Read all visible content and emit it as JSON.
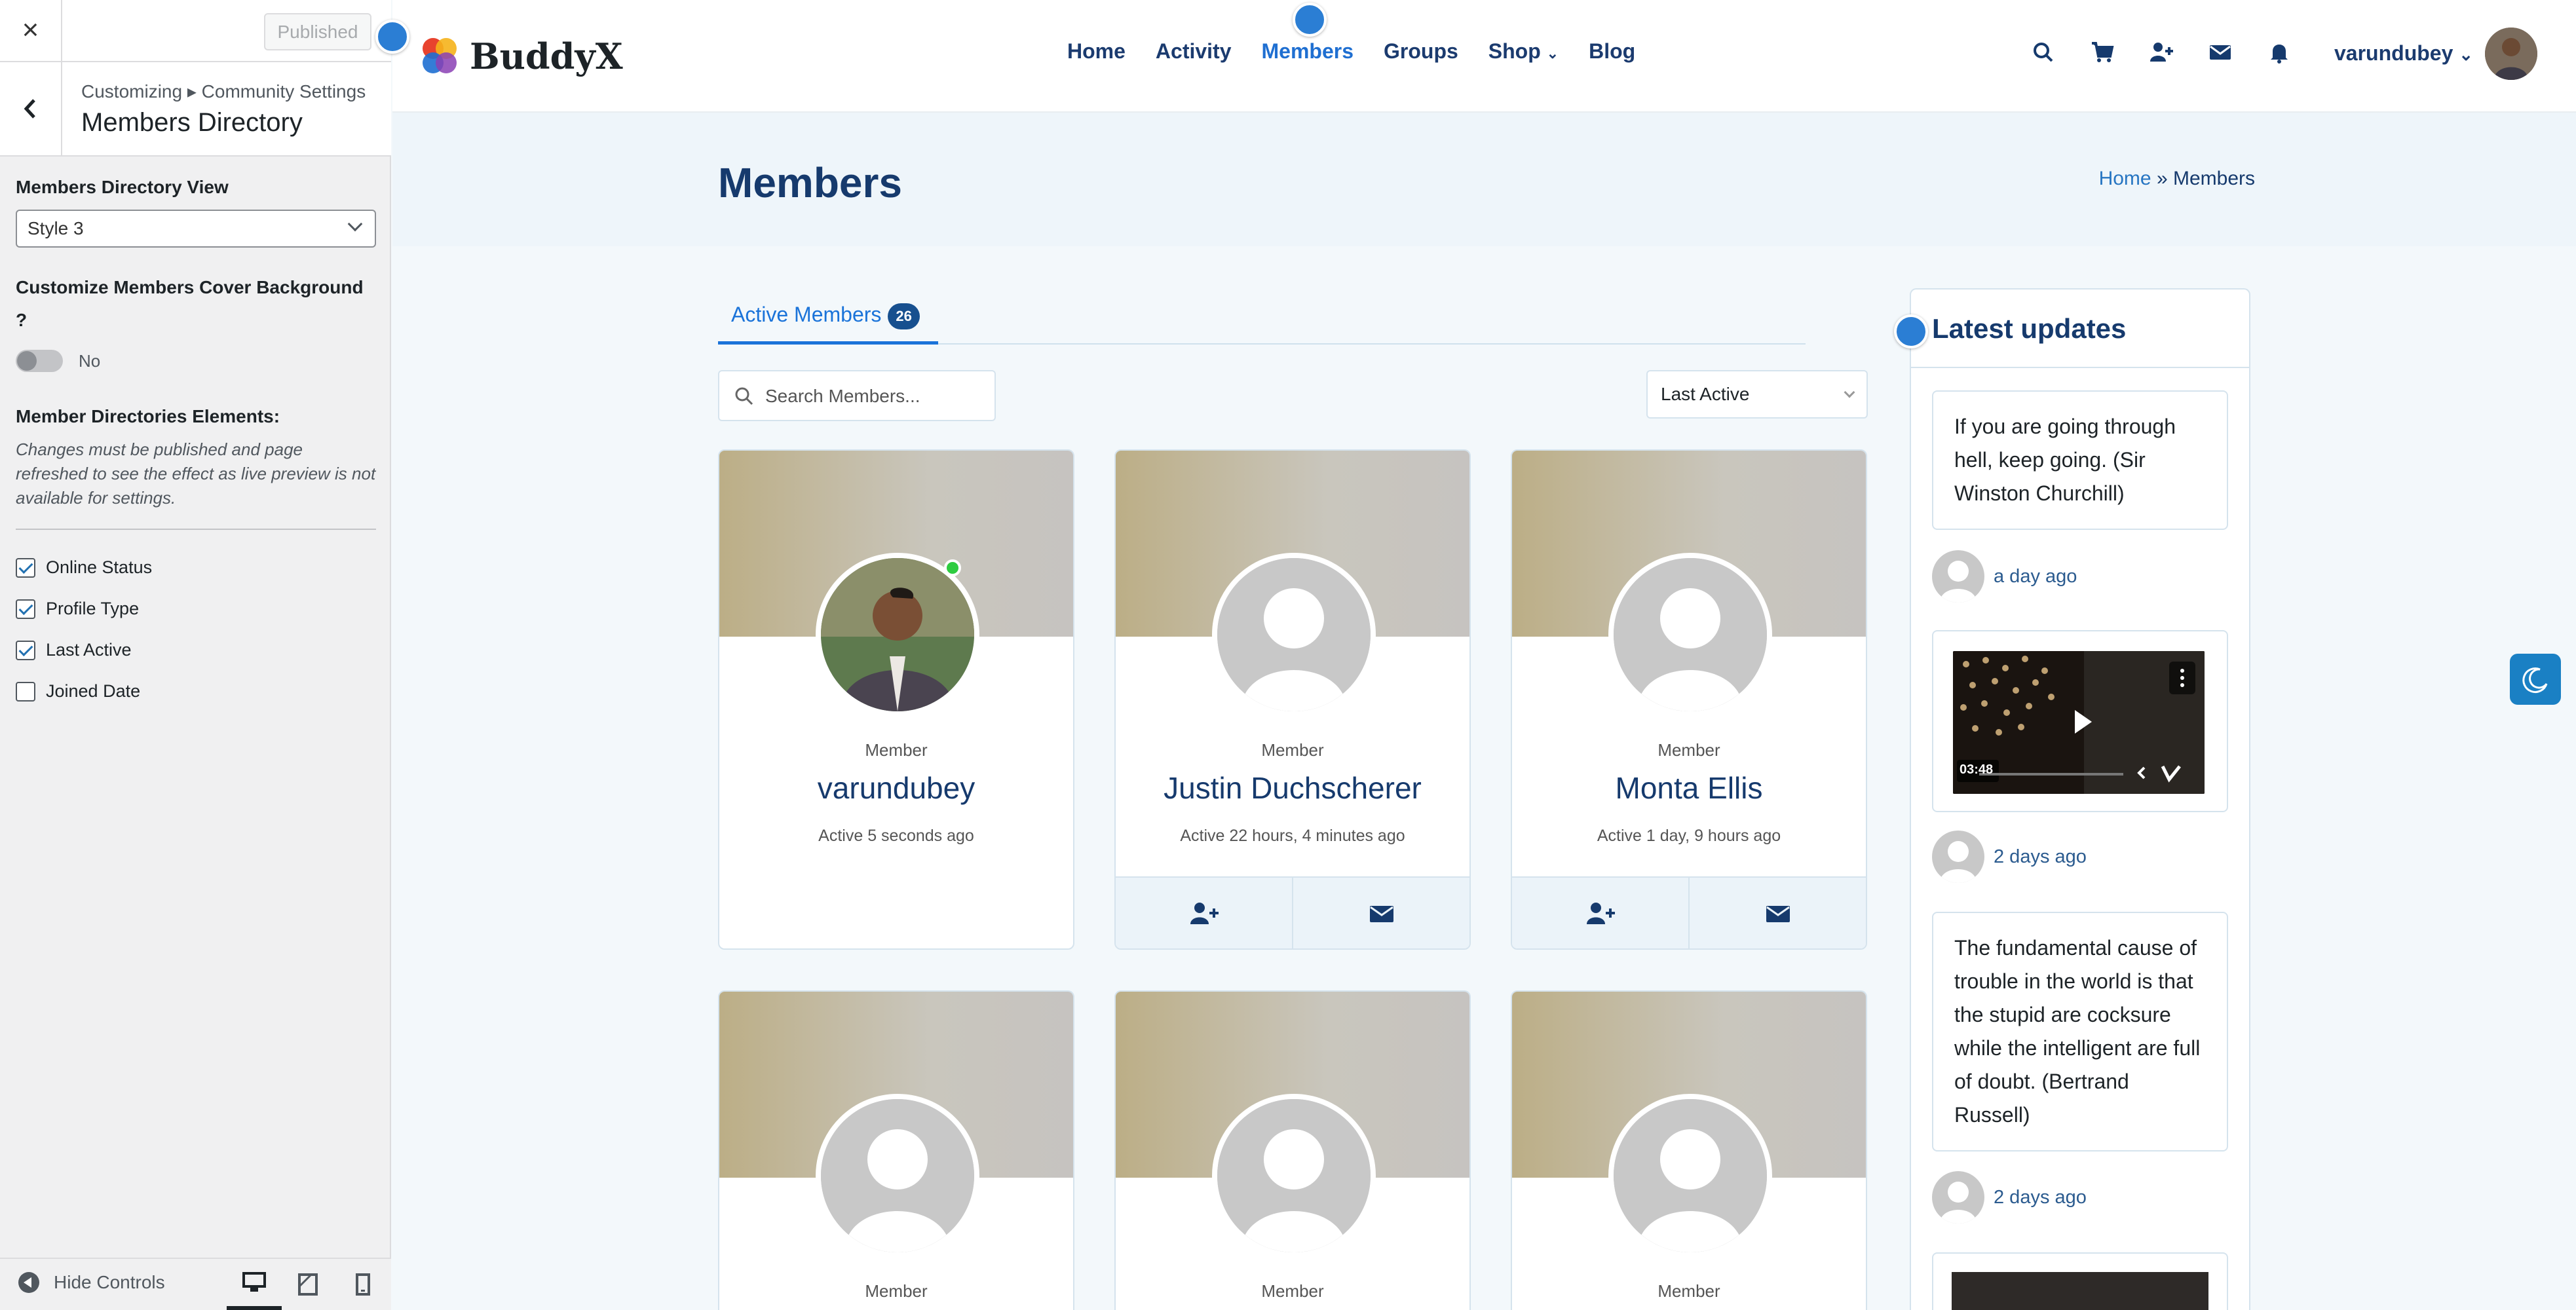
{
  "customizer": {
    "close": "×",
    "published_label": "Published",
    "breadcrumb": "Customizing ▸ Community Settings",
    "title": "Members Directory",
    "view_label": "Members Directory View",
    "view_value": "Style 3",
    "cover_label": "Customize Members Cover Background ?",
    "cover_toggle": "No",
    "elements_label": "Member Directories Elements:",
    "note": "Changes must be published and page refreshed to see the effect as live preview is not available for settings.",
    "elements": [
      {
        "label": "Online Status",
        "checked": true
      },
      {
        "label": "Profile Type",
        "checked": true
      },
      {
        "label": "Last Active",
        "checked": true
      },
      {
        "label": "Joined Date",
        "checked": false
      }
    ],
    "hide_controls": "Hide Controls"
  },
  "site": {
    "logo": "BuddyX",
    "nav": [
      "Home",
      "Activity",
      "Members",
      "Groups",
      "Shop",
      "Blog"
    ],
    "active_nav": "Members",
    "username": "varundubey",
    "page_title": "Members",
    "breadcrumb_home": "Home",
    "breadcrumb_sep": "»",
    "breadcrumb_current": "Members",
    "tab_label": "Active Members",
    "tab_count": "26",
    "search_placeholder": "Search Members...",
    "sort_value": "Last Active",
    "colors": {
      "primary": "#163a6d",
      "accent": "#1a73d9",
      "online": "#2ecc40"
    }
  },
  "members": [
    {
      "type": "Member",
      "name": "varundubey",
      "active": "Active 5 seconds ago"
    },
    {
      "type": "Member",
      "name": "Justin Duchscherer",
      "active": "Active 22 hours, 4 minutes ago"
    },
    {
      "type": "Member",
      "name": "Monta Ellis",
      "active": "Active 1 day, 9 hours ago"
    },
    {
      "type": "Member"
    },
    {
      "type": "Member"
    },
    {
      "type": "Member"
    }
  ],
  "widget": {
    "title": "Latest updates",
    "updates": [
      {
        "text": "If you are going through hell, keep going. (Sir Winston Churchill)",
        "time": "a day ago"
      },
      {
        "video_duration": "03:48",
        "time": "2 days ago"
      },
      {
        "text": "The fundamental cause of trouble in the world is that the stupid are cocksure while the intelligent are full of doubt. (Bertrand Russell)",
        "time": "2 days ago"
      }
    ]
  }
}
